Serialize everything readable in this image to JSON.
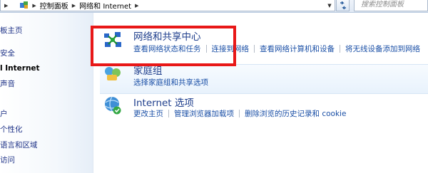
{
  "address_bar": {
    "breadcrumbs": [
      "控制面板",
      "网络和 Internet"
    ],
    "search_placeholder": "搜索控制面板"
  },
  "sidebar": {
    "items": [
      {
        "label": "板主页"
      },
      {
        "label": "安全"
      },
      {
        "label": "l Internet"
      },
      {
        "label": "声音"
      },
      {
        "label": "户"
      },
      {
        "label": "个性化"
      },
      {
        "label": "语言和区域"
      },
      {
        "label": "访问"
      }
    ]
  },
  "categories": {
    "network_center": {
      "title": "网络和共享中心",
      "links": [
        "查看网络状态和任务",
        "连接到网络",
        "查看网络计算机和设备",
        "将无线设备添加到网络"
      ]
    },
    "homegroup": {
      "title": "家庭组",
      "links": [
        "选择家庭组和共享选项"
      ]
    },
    "internet_options": {
      "title": "Internet 选项",
      "links": [
        "更改主页",
        "管理浏览器加载项",
        "删除浏览的历史记录和 cookie"
      ]
    }
  },
  "colors": {
    "highlight": "#e81818",
    "link": "#1a4fa6",
    "title": "#1e3e8c"
  }
}
